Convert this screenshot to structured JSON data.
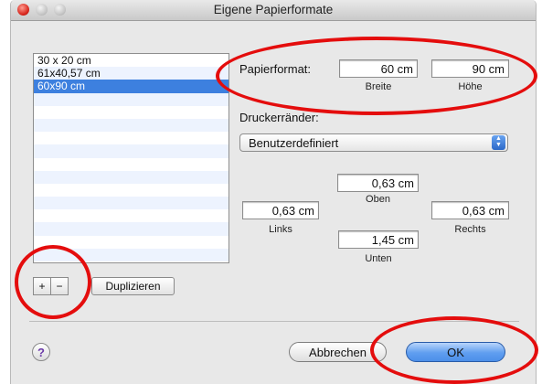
{
  "window": {
    "title": "Eigene Papierformate"
  },
  "paper_list": {
    "items": [
      "30 x 20 cm",
      "61x40,57 cm",
      "60x90 cm"
    ],
    "selected": "60x90 cm"
  },
  "list_buttons": {
    "add": "+",
    "remove": "−",
    "duplicate": "Duplizieren"
  },
  "paper_size": {
    "label": "Papierformat:",
    "width_value": "60 cm",
    "width_caption": "Breite",
    "height_value": "90 cm",
    "height_caption": "Höhe"
  },
  "margins": {
    "label": "Druckerränder:",
    "preset": "Benutzerdefiniert",
    "top_value": "0,63 cm",
    "top_caption": "Oben",
    "left_value": "0,63 cm",
    "left_caption": "Links",
    "right_value": "0,63 cm",
    "right_caption": "Rechts",
    "bottom_value": "1,45 cm",
    "bottom_caption": "Unten"
  },
  "footer": {
    "help": "?",
    "cancel": "Abbrechen",
    "ok": "OK"
  },
  "colors": {
    "annotation": "#e40d0d",
    "selection": "#3d80df",
    "default_button": "#5f9ef0"
  }
}
